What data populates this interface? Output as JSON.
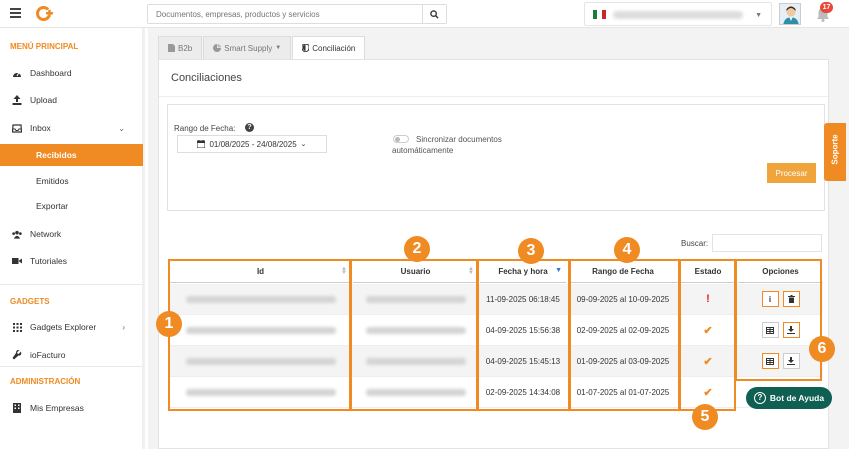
{
  "header": {
    "search_placeholder": "Documentos, empresas, productos y servicios",
    "notifications_count": "17"
  },
  "sidebar": {
    "main_title": "MENÚ PRINCIPAL",
    "items": [
      {
        "label": "Dashboard",
        "icon": "dashboard-icon"
      },
      {
        "label": "Upload",
        "icon": "upload-icon"
      },
      {
        "label": "Inbox",
        "icon": "inbox-icon"
      },
      {
        "label": "Recibidos",
        "icon": ""
      },
      {
        "label": "Emitidos",
        "icon": ""
      },
      {
        "label": "Exportar",
        "icon": ""
      },
      {
        "label": "Network",
        "icon": "network-icon"
      },
      {
        "label": "Tutoriales",
        "icon": "video-icon"
      }
    ],
    "gadgets_title": "GADGETS",
    "gadget_items": [
      {
        "label": "Gadgets Explorer",
        "icon": "grid-icon"
      },
      {
        "label": "ioFacturo",
        "icon": "wrench-icon"
      }
    ],
    "admin_title": "ADMINISTRACIÓN",
    "admin_items": [
      {
        "label": "Mis Empresas",
        "icon": "building-icon"
      }
    ]
  },
  "tabs": [
    {
      "label": "B2b",
      "active": false
    },
    {
      "label": "Smart Supply",
      "active": false
    },
    {
      "label": "Conciliación",
      "active": true
    }
  ],
  "panel": {
    "title": "Conciliaciones",
    "date_label": "Rango de Fecha:",
    "date_range": "01/08/2025 - 24/08/2025",
    "sync_label": "Sincronizar documentos automáticamente",
    "process_button": "Procesar",
    "search_label": "Buscar:"
  },
  "table": {
    "columns": [
      "Id",
      "Usuario",
      "Fecha y hora",
      "Rango de Fecha",
      "Estado",
      "Opciones"
    ],
    "rows": [
      {
        "fecha": "11-09-2025 06:18:45",
        "rango": "09-09-2025 al 10-09-2025",
        "estado": "!"
      },
      {
        "fecha": "04-09-2025 15:56:38",
        "rango": "02-09-2025 al 02-09-2025",
        "estado": "✔"
      },
      {
        "fecha": "04-09-2025 15:45:13",
        "rango": "01-09-2025 al 03-09-2025",
        "estado": "✔"
      },
      {
        "fecha": "02-09-2025 14:34:08",
        "rango": "01-07-2025 al 01-07-2025",
        "estado": "✔"
      }
    ]
  },
  "annotations": [
    "1",
    "2",
    "3",
    "4",
    "5",
    "6"
  ],
  "support_label": "Soporte",
  "bot_label": "Bot de Ayuda",
  "colors": {
    "accent": "#f08a22",
    "error": "#e02020",
    "bot": "#0f5f52"
  }
}
